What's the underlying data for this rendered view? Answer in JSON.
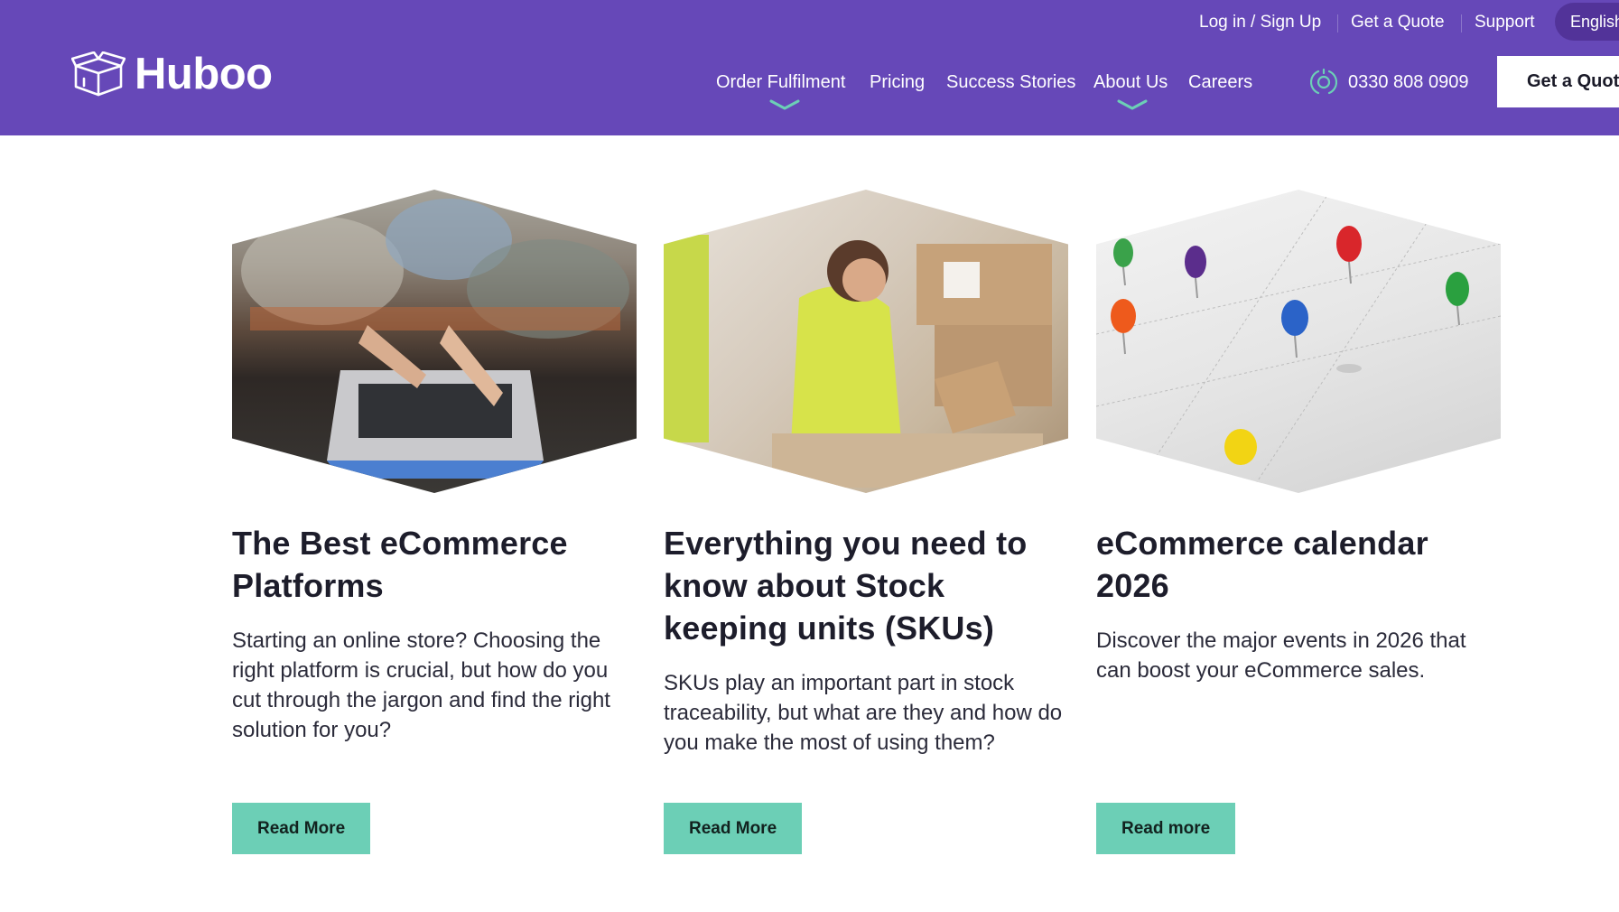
{
  "brand": {
    "name": "Huboo"
  },
  "utility_nav": {
    "login": "Log in / Sign Up",
    "quote": "Get a Quote",
    "support": "Support",
    "language": "English"
  },
  "main_nav": {
    "items": [
      {
        "label": "Order Fulfilment",
        "has_dropdown": true
      },
      {
        "label": "Pricing",
        "has_dropdown": false
      },
      {
        "label": "Success Stories",
        "has_dropdown": false
      },
      {
        "label": "About Us",
        "has_dropdown": true
      },
      {
        "label": "Careers",
        "has_dropdown": false
      }
    ],
    "phone": "0330 808 0909",
    "cta": "Get a Quote"
  },
  "articles": [
    {
      "title": "The Best eCommerce Platforms",
      "description": "Starting an online store? Choosing the right platform is crucial, but how do you cut through the jargon and find the right solution for you?",
      "button": "Read More"
    },
    {
      "title": "Everything you need to know about Stock keeping units (SKUs)",
      "description": "SKUs play an important part in stock traceability, but what are they and how do you make the most of using them?",
      "button": "Read More"
    },
    {
      "title": "eCommerce calendar 2026",
      "description": "Discover the major events in 2026 that can boost your eCommerce sales.",
      "button": "Read more"
    }
  ],
  "colors": {
    "header_bg": "#6648b8",
    "accent_teal": "#6ccfb6",
    "pill_bg": "#523399",
    "text_dark": "#1d1d2b"
  }
}
